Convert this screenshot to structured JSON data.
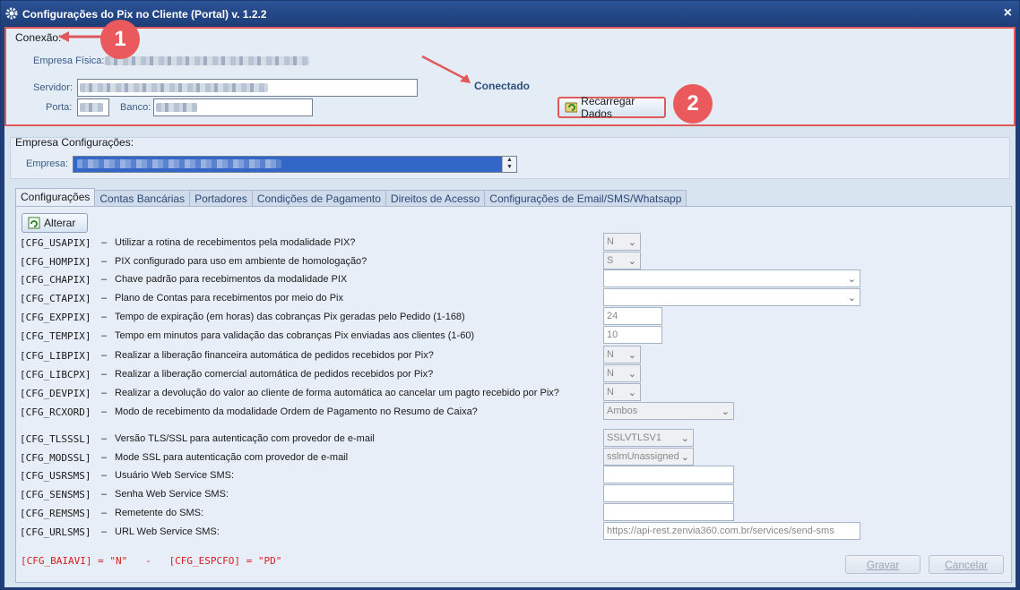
{
  "window": {
    "title": "Configurações do Pix no Cliente (Portal) v. 1.2.2",
    "close": "×"
  },
  "conexao": {
    "label": "Conexão:",
    "empresa_fisica_label": "Empresa Física:",
    "servidor_label": "Servidor:",
    "porta_label": "Porta:",
    "banco_label": "Banco:",
    "status": "Conectado",
    "reload_button": "Recarregar Dados"
  },
  "empresa_config": {
    "label": "Empresa Configurações:",
    "empresa_label": "Empresa:"
  },
  "annotations": [
    "1",
    "2"
  ],
  "tabs": [
    {
      "label": "Configurações",
      "active": true
    },
    {
      "label": "Contas Bancárias"
    },
    {
      "label": "Portadores"
    },
    {
      "label": "Condições de Pagamento"
    },
    {
      "label": "Direitos de Acesso"
    },
    {
      "label": "Configurações de Email/SMS/Whatsapp"
    }
  ],
  "alterar_button": "Alterar",
  "dash": "–",
  "rows": [
    {
      "code": "[CFG_USAPIX]",
      "desc": "Utilizar a rotina de recebimentos pela modalidade PIX?",
      "value": "N"
    },
    {
      "code": "[CFG_HOMPIX]",
      "desc": "PIX configurado para uso em ambiente de homologação?",
      "value": "S"
    },
    {
      "code": "[CFG_CHAPIX]",
      "desc": "Chave padrão para recebimentos da modalidade PIX",
      "value": ""
    },
    {
      "code": "[CFG_CTAPIX]",
      "desc": "Plano de Contas para recebimentos por meio do Pix",
      "value": ""
    },
    {
      "code": "[CFG_EXPPIX]",
      "desc": "Tempo de expiração (em horas) das cobranças Pix geradas pelo Pedido (1-168)",
      "value": "24"
    },
    {
      "code": "[CFG_TEMPIX]",
      "desc": "Tempo em minutos para validação das cobranças Pix enviadas aos clientes (1-60)",
      "value": "10"
    },
    {
      "code": "[CFG_LIBPIX]",
      "desc": "Realizar a liberação financeira automática de pedidos recebidos por Pix?",
      "value": "N"
    },
    {
      "code": "[CFG_LIBCPX]",
      "desc": "Realizar a liberação comercial automática de pedidos recebidos por Pix?",
      "value": "N"
    },
    {
      "code": "[CFG_DEVPIX]",
      "desc": "Realizar a devolução do valor ao cliente de forma automática ao cancelar um pagto recebido por Pix?",
      "value": "N"
    },
    {
      "code": "[CFG_RCXORD]",
      "desc": "Modo de recebimento da modalidade Ordem de Pagamento no Resumo de Caixa?",
      "value": "Ambos"
    },
    {
      "code": "[CFG_TLSSSL]",
      "desc": "Versão TLS/SSL para autenticação com provedor de e-mail",
      "value": "SSLVTLSV1"
    },
    {
      "code": "[CFG_MODSSL]",
      "desc": "Mode SSL para autenticação com provedor de e-mail",
      "value": "sslmUnassigned"
    },
    {
      "code": "[CFG_USRSMS]",
      "desc": "Usuário Web Service SMS:",
      "value": ""
    },
    {
      "code": "[CFG_SENSMS]",
      "desc": "Senha Web Service SMS:",
      "value": ""
    },
    {
      "code": "[CFG_REMSMS]",
      "desc": "Remetente do SMS:",
      "value": ""
    },
    {
      "code": "[CFG_URLSMS]",
      "desc": "URL Web Service SMS:",
      "value": "https://api-rest.zenvia360.com.br/services/send-sms"
    }
  ],
  "footer_note": "[CFG_BAIAVI] = \"N\"   -   [CFG_ESPCFO] = \"PD\"",
  "gravar_button": "Gravar",
  "cancelar_button": "Cancelar",
  "colors": {
    "title_bar": "#1c3d78",
    "highlight": "#e05a5a",
    "status": "#2c4f7e",
    "footer_red": "#d42020"
  }
}
